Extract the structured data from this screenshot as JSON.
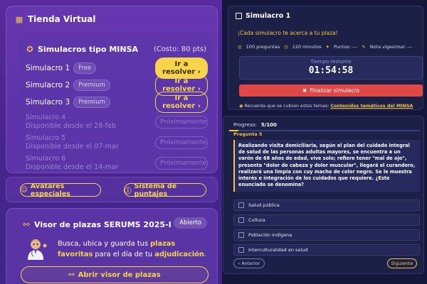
{
  "store": {
    "title": "Tienda Virtual",
    "section_title": "Simulacros tipo MINSA",
    "cost": "(Costo: 80 pts)",
    "simulacros": [
      {
        "name": "Simulacro 1",
        "badge": "Free",
        "button": "Ir a resolver"
      },
      {
        "name": "Simulacro 2",
        "badge": "Premium",
        "button": "Ir a resolver"
      },
      {
        "name": "Simulacro 3",
        "badge": "Premium",
        "button": "Ir a resolver"
      }
    ],
    "upcoming": [
      {
        "name": "Simulacro 4",
        "date": "Disponible desde el 28-feb",
        "button": "Próximamente"
      },
      {
        "name": "Simulacro 5",
        "date": "Disponible desde el 07-mar",
        "button": "Próximamente"
      },
      {
        "name": "Simulacro 6",
        "date": "Disponible desde el 14-mar",
        "button": "Próximamente"
      }
    ]
  },
  "pills": {
    "avatars": "Avatares especiales",
    "points": "Sistema de puntajes"
  },
  "visor": {
    "title": "Visor de plazas SERUMS 2025-I",
    "status": "Abierto",
    "text_a": "Busca, ubica y guarda tus ",
    "text_hl1": "plazas favoritas",
    "text_b": " para el día de tu ",
    "text_hl2": "adjudicación",
    "text_c": ".",
    "button": "Abrir visor de plazas"
  },
  "simulacro": {
    "title": "Simulacro 1",
    "subtitle": "¡Cada simulacro te acerca a tu plaza!",
    "stats": {
      "preguntas": "100 preguntas",
      "minutos": "120 minutos",
      "puntos": "Puntos: ---",
      "nota": "Nota vigesimal: ---"
    },
    "timer_label": "Tiempo restante",
    "timer": "01:54:58",
    "finish_button": "Finalizar simulacro",
    "reminder": "Recuerda que se cubren estos temas: ",
    "reminder_link": "Contenidos temáticos del MINSA"
  },
  "question": {
    "progress_label": "Progreso:",
    "progress_value": "5/100",
    "progress_fraction": 0.05,
    "label": "Pregunta 5",
    "text": "Realizando visita domiciliaria, según el plan del cuidado integral de salud de las personas adultas mayores, se encuentra a un varón de 68 años de edad, vive solo; refiere tener \"mal de ojo\", presenta \"dolor de cabeza y dolor muscular\", llegará el curandero, realizará una limpia con cuy macho de color negro. Se le muestra interés e integración de los cuidados que requiere. ¿Este enunciado se denomina?",
    "options": [
      "Salud pública",
      "Cultura",
      "Población indígena",
      "Interculturalidad en salud"
    ],
    "prev": "‹ Anterior",
    "next": "Siguiente"
  },
  "colors": {
    "accent": "#f6c343",
    "danger": "#e04848",
    "panel_left": "#4a2590",
    "panel_right": "#1d2046"
  }
}
